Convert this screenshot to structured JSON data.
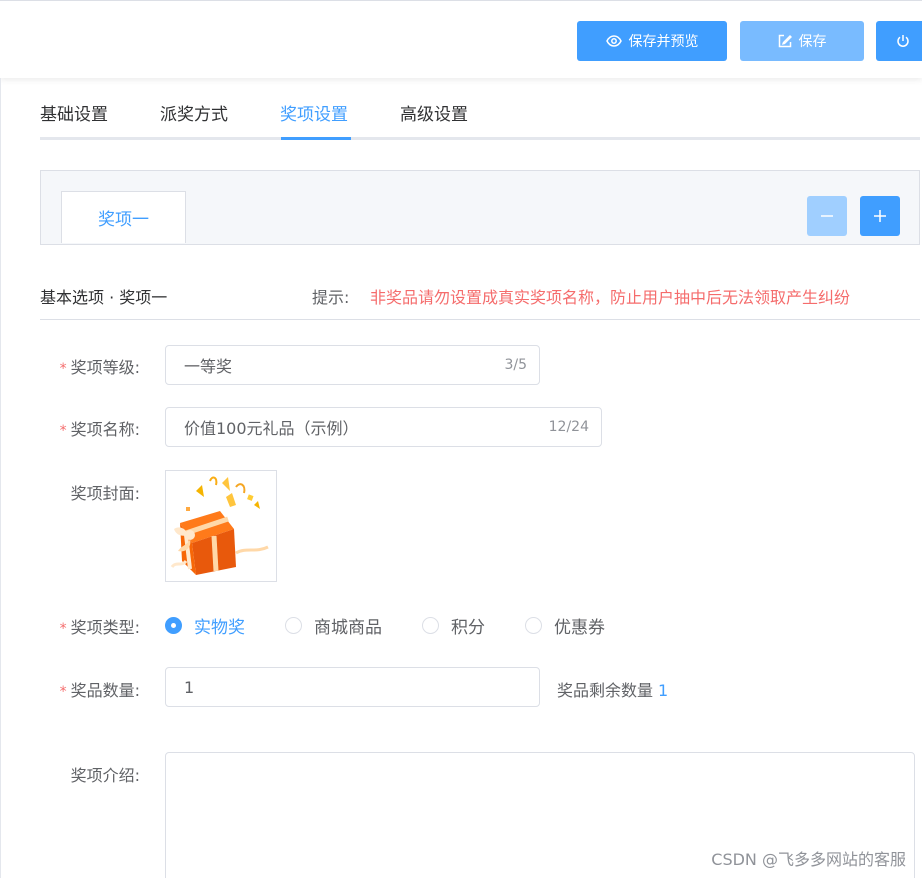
{
  "toolbar": {
    "preview_label": "保存并预览",
    "save_label": "保存"
  },
  "tabs": [
    {
      "label": "基础设置",
      "active": false
    },
    {
      "label": "派奖方式",
      "active": false
    },
    {
      "label": "奖项设置",
      "active": true
    },
    {
      "label": "高级设置",
      "active": false
    }
  ],
  "prize_tabs": [
    {
      "label": "奖项一"
    }
  ],
  "section": {
    "title": "基本选项 · 奖项一",
    "hint_label": "提示:",
    "hint_text": "非奖品请勿设置成真实奖项名称，防止用户抽中后无法领取产生纠纷"
  },
  "form": {
    "level": {
      "label": "奖项等级:",
      "value": "一等奖",
      "count": "3/5",
      "required": true
    },
    "name": {
      "label": "奖项名称:",
      "value": "价值100元礼品（示例）",
      "count": "12/24",
      "required": true
    },
    "cover": {
      "label": "奖项封面:",
      "required": false
    },
    "type": {
      "label": "奖项类型:",
      "required": true,
      "options": [
        {
          "label": "实物奖",
          "checked": true
        },
        {
          "label": "商城商品",
          "checked": false
        },
        {
          "label": "积分",
          "checked": false
        },
        {
          "label": "优惠券",
          "checked": false
        }
      ]
    },
    "quantity": {
      "label": "奖品数量:",
      "value": "1",
      "required": true,
      "remaining_label": "奖品剩余数量",
      "remaining_value": "1"
    },
    "intro": {
      "label": "奖项介绍:",
      "value": "",
      "required": false
    }
  },
  "watermark": "CSDN @飞多多网站的客服",
  "colors": {
    "primary": "#409eff",
    "primary_light": "#79bbff",
    "danger": "#f56c6c"
  }
}
